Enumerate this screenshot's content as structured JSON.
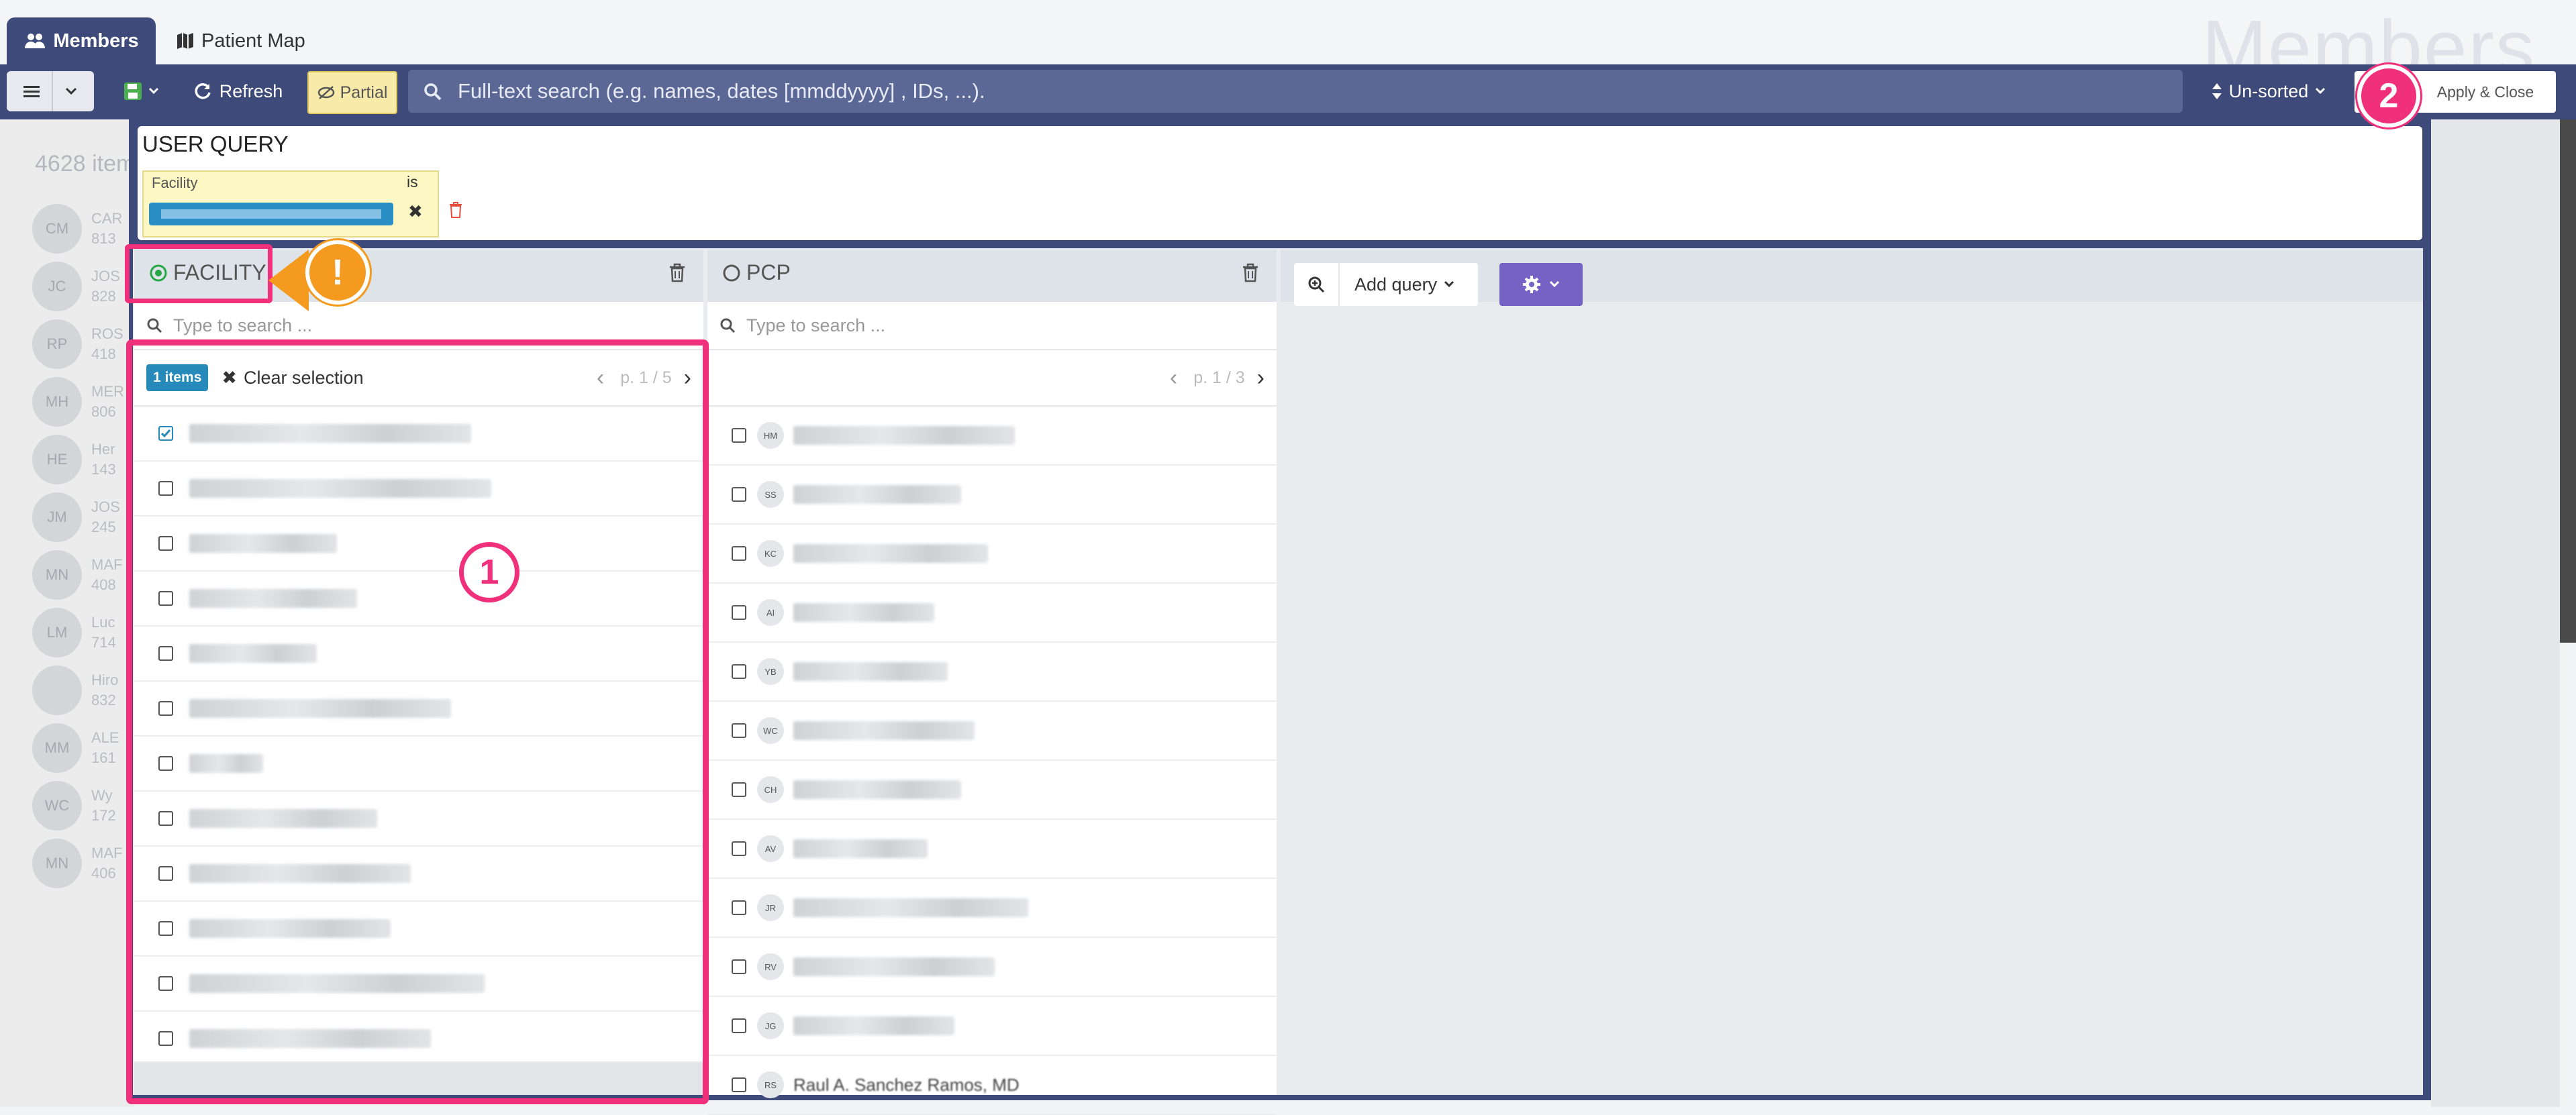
{
  "tabs": {
    "members": "Members",
    "patient_map": "Patient Map"
  },
  "watermark": "Members",
  "toolbar": {
    "refresh": "Refresh",
    "partial": "Partial",
    "search_placeholder": "Full-text search (e.g. names, dates [mmddyyyy] , IDs, ...).",
    "sort": "Un-sorted",
    "apply": "Apply & Close"
  },
  "background": {
    "count": "4628 item",
    "rows": [
      {
        "initials": "CM",
        "text": "CAR",
        "sub": "813"
      },
      {
        "initials": "JC",
        "text": "JOS",
        "sub": "828"
      },
      {
        "initials": "RP",
        "text": "ROS",
        "sub": "418"
      },
      {
        "initials": "MH",
        "text": "MER",
        "sub": "806"
      },
      {
        "initials": "HE",
        "text": "Her",
        "sub": "143"
      },
      {
        "initials": "JM",
        "text": "JOS",
        "sub": "245"
      },
      {
        "initials": "MN",
        "text": "MAF",
        "sub": "408"
      },
      {
        "initials": "LM",
        "text": "Luc",
        "sub": "714"
      },
      {
        "initials": "",
        "text": "Hiro",
        "sub": "832"
      },
      {
        "initials": "MM",
        "text": "ALE",
        "sub": "161"
      },
      {
        "initials": "WC",
        "text": "Wy",
        "sub": "172"
      },
      {
        "initials": "MN",
        "text": "MAF",
        "sub": "406"
      }
    ]
  },
  "user_query": {
    "title": "USER QUERY",
    "facility_label": "Facility",
    "operator": "is"
  },
  "facility": {
    "title": "FACILITY",
    "search_placeholder": "Type to search ...",
    "selected_badge": "1 items",
    "clear": "Clear selection",
    "page": "p. 1 / 5"
  },
  "pcp": {
    "title": "PCP",
    "search_placeholder": "Type to search ...",
    "page": "p. 1 / 3",
    "rows": [
      {
        "initials": "HM"
      },
      {
        "initials": "SS"
      },
      {
        "initials": "KC"
      },
      {
        "initials": "AI"
      },
      {
        "initials": "YB"
      },
      {
        "initials": "WC"
      },
      {
        "initials": "CH"
      },
      {
        "initials": "AV"
      },
      {
        "initials": "JR"
      },
      {
        "initials": "RV"
      },
      {
        "initials": "JG"
      },
      {
        "initials": "RS",
        "name": "Raul A. Sanchez Ramos, MD"
      }
    ]
  },
  "query_builder": {
    "add_query": "Add query"
  },
  "annotations": {
    "warning": "!",
    "step1": "1",
    "step2": "2"
  }
}
